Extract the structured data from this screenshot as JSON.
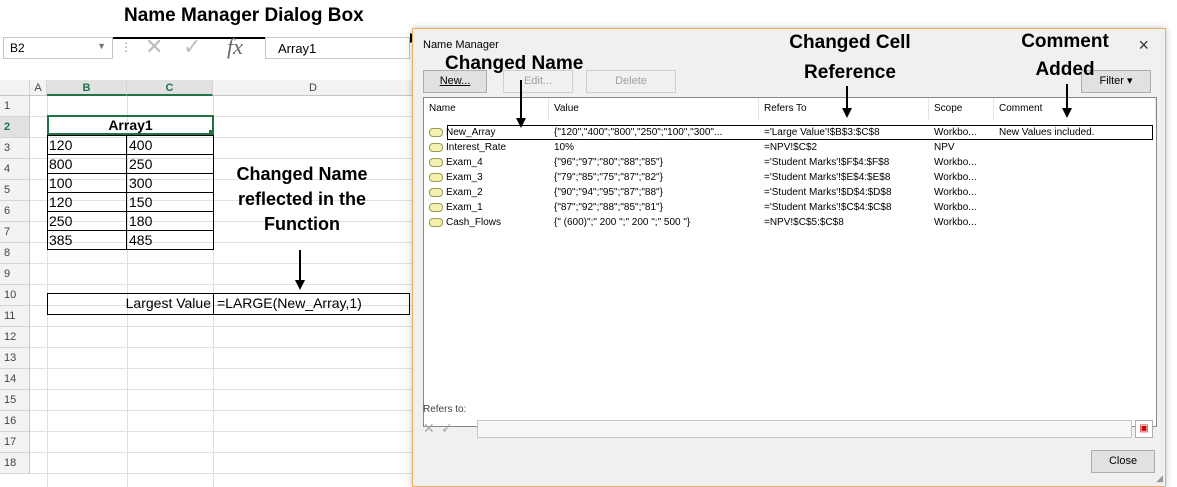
{
  "annotations": {
    "dialog_box": "Name Manager Dialog Box",
    "changed_name": "Changed Name",
    "changed_cell_ref_1": "Changed Cell",
    "changed_cell_ref_2": "Reference",
    "comment_added_1": "Comment",
    "comment_added_2": "Added",
    "reflected_1": "Changed Name",
    "reflected_2": "reflected in the",
    "reflected_3": "Function"
  },
  "formula_bar": {
    "name_box": "B2",
    "formula": "Array1",
    "fx": "fx"
  },
  "sheet": {
    "columns": [
      "A",
      "B",
      "C",
      "D"
    ],
    "rows": [
      "1",
      "2",
      "3",
      "4",
      "5",
      "6",
      "7",
      "8",
      "9",
      "10",
      "11",
      "12",
      "13",
      "14",
      "15",
      "16",
      "17",
      "18"
    ],
    "table_header": "Array1",
    "table": [
      [
        "120",
        "400"
      ],
      [
        "800",
        "250"
      ],
      [
        "100",
        "300"
      ],
      [
        "120",
        "150"
      ],
      [
        "250",
        "180"
      ],
      [
        "385",
        "485"
      ]
    ],
    "largest_label": "Largest Value",
    "largest_formula": "=LARGE(New_Array,1)"
  },
  "dialog": {
    "title": "Name Manager",
    "close": "×",
    "new_button": "New...",
    "edit_button": "Edit...",
    "delete_button": "Delete",
    "filter_button": "Filter ▾",
    "columns": [
      "Name",
      "Value",
      "Refers To",
      "Scope",
      "Comment"
    ],
    "rows": [
      {
        "name": "New_Array",
        "value": "{\"120\",\"400\";\"800\",\"250\";\"100\",\"300\"...",
        "refers": "='Large Value'!$B$3:$C$8",
        "scope": "Workbo...",
        "comment": "New Values included."
      },
      {
        "name": "Interest_Rate",
        "value": "10%",
        "refers": "=NPV!$C$2",
        "scope": "NPV",
        "comment": ""
      },
      {
        "name": "Exam_4",
        "value": "{\"96\";\"97\";\"80\";\"88\";\"85\"}",
        "refers": "='Student Marks'!$F$4:$F$8",
        "scope": "Workbo...",
        "comment": ""
      },
      {
        "name": "Exam_3",
        "value": "{\"79\";\"85\";\"75\";\"87\";\"82\"}",
        "refers": "='Student Marks'!$E$4:$E$8",
        "scope": "Workbo...",
        "comment": ""
      },
      {
        "name": "Exam_2",
        "value": "{\"90\";\"94\";\"95\";\"87\";\"88\"}",
        "refers": "='Student Marks'!$D$4:$D$8",
        "scope": "Workbo...",
        "comment": ""
      },
      {
        "name": "Exam_1",
        "value": "{\"87\";\"92\";\"88\";\"85\";\"81\"}",
        "refers": "='Student Marks'!$C$4:$C$8",
        "scope": "Workbo...",
        "comment": ""
      },
      {
        "name": "Cash_Flows",
        "value": "{\" (600)\";\" 200 \";\" 200 \";\" 500 \"}",
        "refers": "=NPV!$C$5:$C$8",
        "scope": "Workbo...",
        "comment": ""
      }
    ],
    "refers_to_label": "Refers to:",
    "close_button": "Close"
  },
  "colors": {
    "excel_green": "#217346",
    "dialog_border": "#f0ad69"
  }
}
